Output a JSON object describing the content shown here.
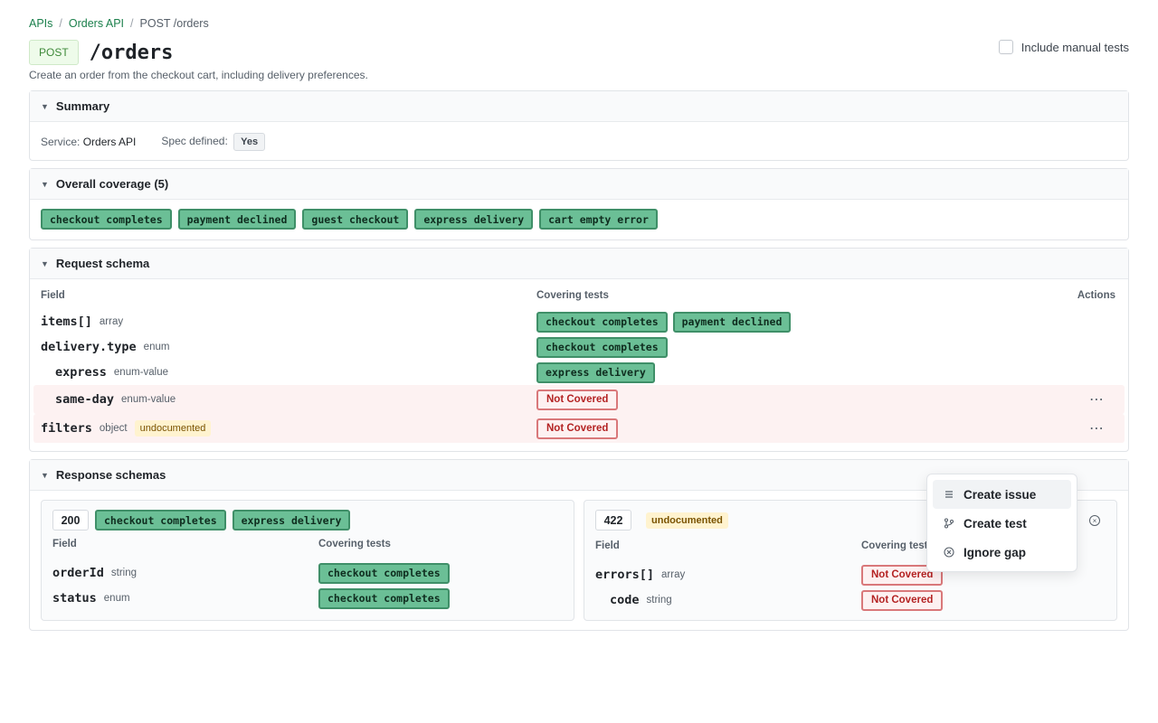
{
  "breadcrumb": {
    "items": [
      "APIs",
      "Orders API",
      "POST /orders"
    ],
    "separator": "/"
  },
  "endpoint": {
    "method": "POST",
    "path": "/orders",
    "description": "Create an order from the checkout cart, including delivery preferences."
  },
  "manual_toggle": {
    "label": "Include manual tests",
    "checked": false
  },
  "summary": {
    "title": "Summary",
    "service_label": "Service:",
    "service_value": "Orders API",
    "spec_label": "Spec defined:",
    "spec_value": "Yes"
  },
  "coverage": {
    "title": "Overall coverage (5)",
    "tests": [
      "checkout completes",
      "payment declined",
      "guest checkout",
      "express delivery",
      "cart empty error"
    ]
  },
  "request": {
    "title": "Request schema",
    "headers": {
      "field": "Field",
      "tests": "Covering tests",
      "actions": "Actions"
    },
    "rows": [
      {
        "name": "items[]",
        "type": "array",
        "tests": [
          "checkout completes",
          "payment declined"
        ]
      },
      {
        "name": "delivery.type",
        "type": "enum",
        "tests": [
          "checkout completes"
        ]
      },
      {
        "name": "express",
        "type": "enum-value",
        "tests": [
          "express delivery"
        ]
      },
      {
        "name": "same-day",
        "type": "enum-value",
        "status": "Not Covered"
      },
      {
        "name": "filters",
        "type": "object",
        "badge": "undocumented",
        "status": "Not Covered"
      }
    ]
  },
  "response": {
    "title": "Response schemas",
    "cards": [
      {
        "code": "200",
        "tests": [
          "checkout completes",
          "express delivery"
        ],
        "headers": {
          "field": "Field",
          "tests": "Covering tests"
        },
        "rows": [
          {
            "name": "orderId",
            "type": "string",
            "tests": [
              "checkout completes"
            ]
          },
          {
            "name": "status",
            "type": "enum",
            "tests": [
              "checkout completes"
            ]
          }
        ]
      },
      {
        "code": "422",
        "badge": "undocumented",
        "headers": {
          "field": "Field",
          "tests": "Covering tests"
        },
        "rows": [
          {
            "name": "errors[]",
            "type": "array",
            "status": "Not Covered"
          },
          {
            "name": "code",
            "type": "string",
            "status": "Not Covered"
          }
        ]
      }
    ]
  },
  "context_menu": {
    "items": [
      "Create issue",
      "Create test",
      "Ignore gap"
    ],
    "icons": [
      "list-icon",
      "branch-icon",
      "circle-x-icon"
    ]
  },
  "colors": {
    "accent": "#1a7f4b",
    "covered_fill": "#6bbf96",
    "covered_border": "#3f8f68",
    "not_covered": "#b42323",
    "gap_row": "#fdf2f2",
    "undocumented_bg": "#fff3cf"
  }
}
